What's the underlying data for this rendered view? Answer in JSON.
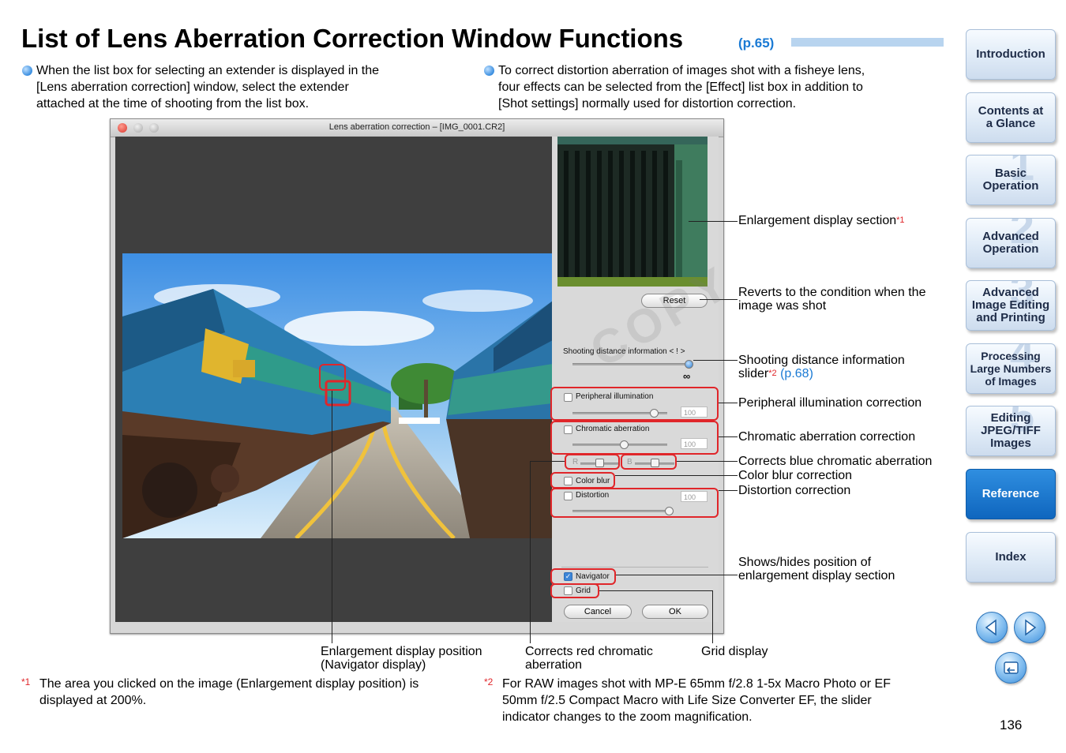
{
  "title": "List of Lens Aberration Correction Window Functions",
  "title_ref": "(p.65)",
  "intro": {
    "left_lines": [
      "When the list box for selecting an extender is displayed in the",
      "[Lens aberration correction] window, select the extender",
      "attached at the time of shooting from the list box."
    ],
    "right_lines": [
      "To correct distortion aberration of images shot with a fisheye lens,",
      "four effects can be selected from the [Effect] list box in addition to",
      "[Shot settings] normally used for distortion correction."
    ]
  },
  "window": {
    "title": "Lens aberration correction – [IMG_0001.CR2]",
    "reset_label": "Reset",
    "shooting_distance_label": "Shooting distance information < ! >",
    "infinity_symbol": "∞",
    "peripheral_label": "Peripheral illumination",
    "peripheral_value": "100",
    "chromatic_label": "Chromatic aberration",
    "chromatic_value": "100",
    "r_label": "R",
    "b_label": "B",
    "color_blur_label": "Color blur",
    "distortion_label": "Distortion",
    "distortion_value": "100",
    "navigator_label": "Navigator",
    "navigator_checked": true,
    "grid_label": "Grid",
    "cancel_label": "Cancel",
    "ok_label": "OK"
  },
  "callouts": {
    "enlargement": "Enlargement display section",
    "enlargement_star": "*1",
    "reverts_lines": [
      "Reverts to the condition when the",
      "image was shot"
    ],
    "shooting_lines": [
      "Shooting distance information",
      "slider"
    ],
    "shooting_star": "*2",
    "shooting_ref": "(p.68)",
    "peripheral": "Peripheral illumination correction",
    "chromatic": "Chromatic aberration correction",
    "blue": "Corrects blue chromatic aberration",
    "color_blur": "Color blur correction",
    "distortion": "Distortion correction",
    "showhide_lines": [
      "Shows/hides position of",
      "enlargement display section"
    ],
    "enl_pos_lines": [
      "Enlargement display position",
      "(Navigator display)"
    ],
    "red_lines": [
      "Corrects red chromatic",
      "aberration"
    ],
    "grid": "Grid display"
  },
  "footnotes": {
    "one_mark": "*1",
    "one_lines": [
      "The area you clicked on the image (Enlargement display position) is",
      "displayed at 200%."
    ],
    "two_mark": "*2",
    "two_lines": [
      "For RAW images shot with MP-E 65mm f/2.8 1-5x Macro Photo or EF",
      "50mm f/2.5 Compact Macro with Life Size Converter EF, the slider",
      "indicator changes to the zoom magnification."
    ]
  },
  "nav": {
    "introduction": "Introduction",
    "contents": [
      "Contents at",
      "a Glance"
    ],
    "basic": [
      "Basic",
      "Operation"
    ],
    "basic_num": "1",
    "advanced": [
      "Advanced",
      "Operation"
    ],
    "advanced_num": "2",
    "editing": [
      "Advanced",
      "Image Editing",
      "and Printing"
    ],
    "editing_num": "3",
    "processing": [
      "Processing",
      "Large Numbers",
      "of Images"
    ],
    "processing_num": "4",
    "jpeg": [
      "Editing",
      "JPEG/TIFF",
      "Images"
    ],
    "jpeg_num": "5",
    "reference": "Reference",
    "index": "Index"
  },
  "page_number": "136",
  "colors": {
    "accent_blue": "#1a7ad4",
    "highlight_red": "#e0262a",
    "nav_active": "#0f66be"
  }
}
